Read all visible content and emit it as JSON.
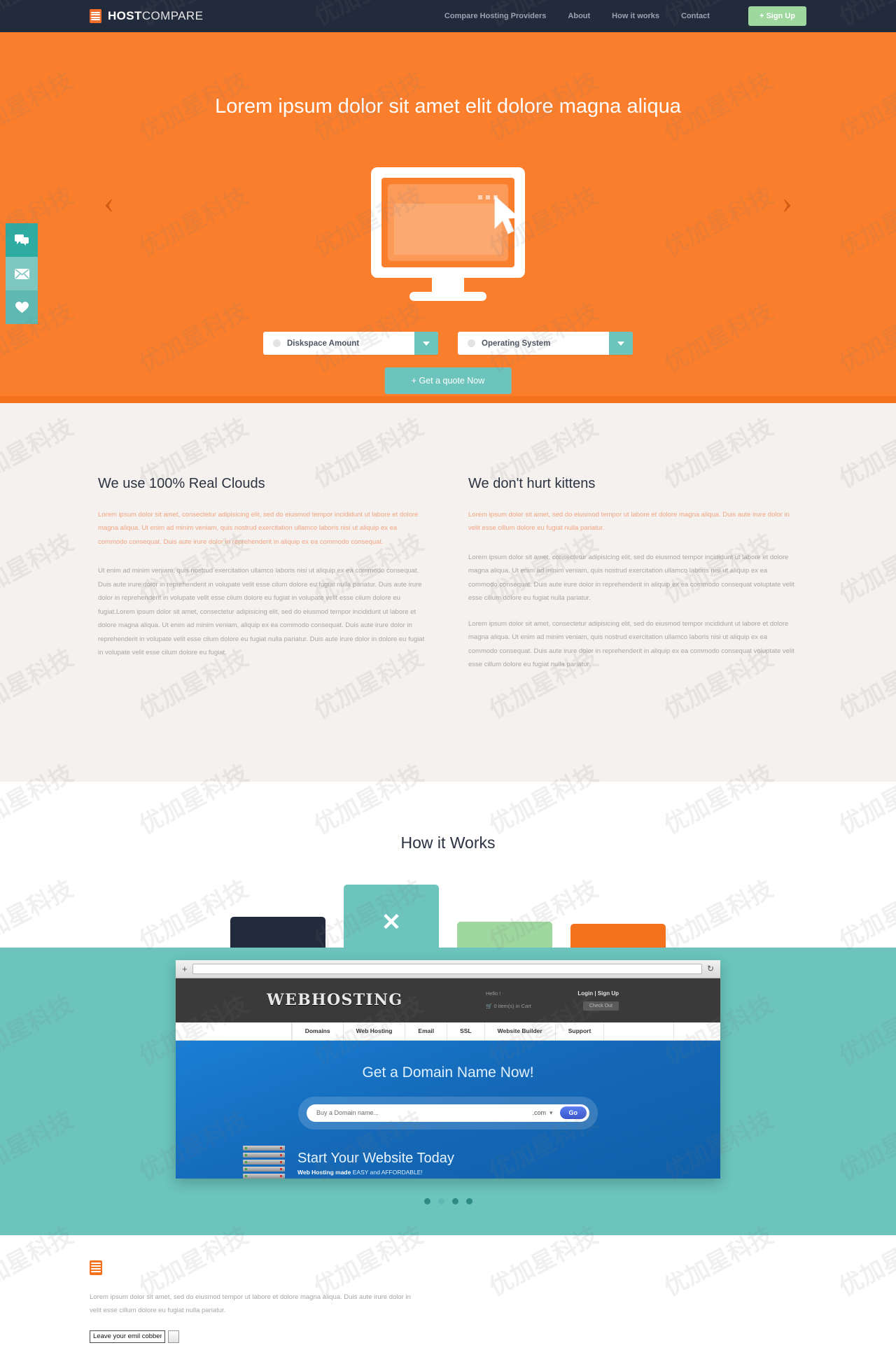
{
  "nav": {
    "logo_bold": "HOST",
    "logo_light": "COMPARE",
    "items": [
      {
        "label": "Compare Hosting Providers"
      },
      {
        "label": "About"
      },
      {
        "label": "How it works"
      },
      {
        "label": "Contact"
      }
    ],
    "signup_label": "+ Sign Up"
  },
  "hero": {
    "title": "Lorem ipsum dolor sit amet elit dolore magna aliqua",
    "arrow_prev": "‹",
    "arrow_next": "›",
    "diskspace_label": "Diskspace Amount",
    "os_label": "Operating System",
    "quote_label": "+ Get a quote Now"
  },
  "rail": [
    {
      "icon": "chat-icon"
    },
    {
      "icon": "envelope-icon"
    },
    {
      "icon": "heart-icon"
    }
  ],
  "features": {
    "left": {
      "heading": "We use 100% Real Clouds",
      "lead": "Lorem ipsum dolor sit amet, consectetur adipisicing elit, sed do eiusmod tempor incididunt ut labore et dolore magna aliqua. Ut enim ad minim veniam, quis nostrud exercitation ullamco laboris nisi ut aliquip ex ea commodo consequat. Duis aute irure dolor in reprehenderit in aliquip ex ea commodo consequat.",
      "body": "Ut enim ad minim veniam, quis nostrud exercitation ullamco laboris nisi ut aliquip ex ea commodo consequat. Duis aute irure dolor in reprehenderit in volupate velit esse cilum dolore eu fugiat nulla pariatur. Duis aute irure dolor in reprehenderit in volupate velit esse cilum dolore eu fugiat in volupate velit esse cilum dolore eu fugiat.Lorem ipsum dolor sit amet, consectetur adipisicing elit, sed do eiusmod tempor incididunt ut labore et dolore magna aliqua. Ut enim ad minim veniam, aliquip ex ea commodo consequat. Duis aute irure dolor in reprehenderit in volupate velit esse cilum dolore eu fugiat nulla pariatur. Duis aute irure dolor in dolore eu fugiat in volupate velit esse cilum dolore eu fugiat."
    },
    "right": {
      "heading": "We don't hurt kittens",
      "lead": "Lorem ipsum dolor sit amet, sed do eiusmod tempor ut labore et dolore magna aliqua. Duis aute irure dolor in velit esse cillum dolore eu fugiat nulla pariatur.",
      "body_1": "Lorem ipsum dolor sit amet, consectetur adipisicing elit, sed do eiusmod tempor incididunt ut labore et dolore magna aliqua. Ut enim ad minim veniam, quis nostrud exercitation ullamco laboris nisi ut aliquip ex ea commodo consequat. Duis aute irure dolor in reprehenderit in aliquip ex ea commodo consequat voluptate velit esse cillum dolore eu fugiat nulla pariatur.",
      "body_2": "Lorem ipsum dolor sit amet, consectetur adipisicing elit, sed do eiusmod tempor incididunt ut labore et dolore magna aliqua. Ut enim ad minim veniam, quis nostrud exercitation ullamco laboris nisi ut aliquip ex ea commodo consequat. Duis aute irure dolor in reprehenderit in aliquip ex ea commodo consequat voluptate velit esse cillum dolore eu fugiat nulla pariatur."
    }
  },
  "how_it_works": {
    "heading": "How it Works",
    "tiles": [
      {
        "name": "tile-navy",
        "color": "#222b3c",
        "glyph": ""
      },
      {
        "name": "tile-teal",
        "color": "#6cc4bd",
        "glyph": "✕"
      },
      {
        "name": "tile-green",
        "color": "#9fd89f",
        "glyph": ""
      },
      {
        "name": "tile-orange",
        "color": "#f4711e",
        "glyph": ""
      }
    ]
  },
  "browser_mock": {
    "plus": "+",
    "reload": "↻",
    "site_logo": "WEBHOSTING",
    "hello": "Hello !",
    "login": "Login | Sign Up",
    "cart": "0 item(s) in Cart",
    "checkout": "Check Out",
    "nav": [
      "Domains",
      "Web Hosting",
      "Email",
      "SSL",
      "Website Builder",
      "Support"
    ],
    "hero_heading": "Get a Domain Name Now!",
    "search_placeholder": "Buy a Domain name...",
    "tld": ".com",
    "go_label": "Go",
    "start_heading": "Start Your Website Today",
    "start_sub_bold": "Web Hosting made",
    "start_sub_rest": "EASY and AFFORDABLE!"
  },
  "carousel": {
    "dots": [
      "active",
      "pale",
      "active",
      "active"
    ]
  },
  "footer": {
    "text": "Lorem ipsum dolor sit amet, sed do eiusmod tempor ut labore et dolore magna aliqua. Duis aute irure dolor in velit esse cillum dolore eu fugiat nulla pariatur.",
    "email_value": "Leave your emil cobber"
  },
  "watermark": "优加星科技",
  "colors": {
    "brand_orange": "#fb7e2c",
    "dark_navy": "#222b3c",
    "teal": "#6cc4bd",
    "green": "#9fd89f",
    "cream": "#f5f1ee"
  }
}
